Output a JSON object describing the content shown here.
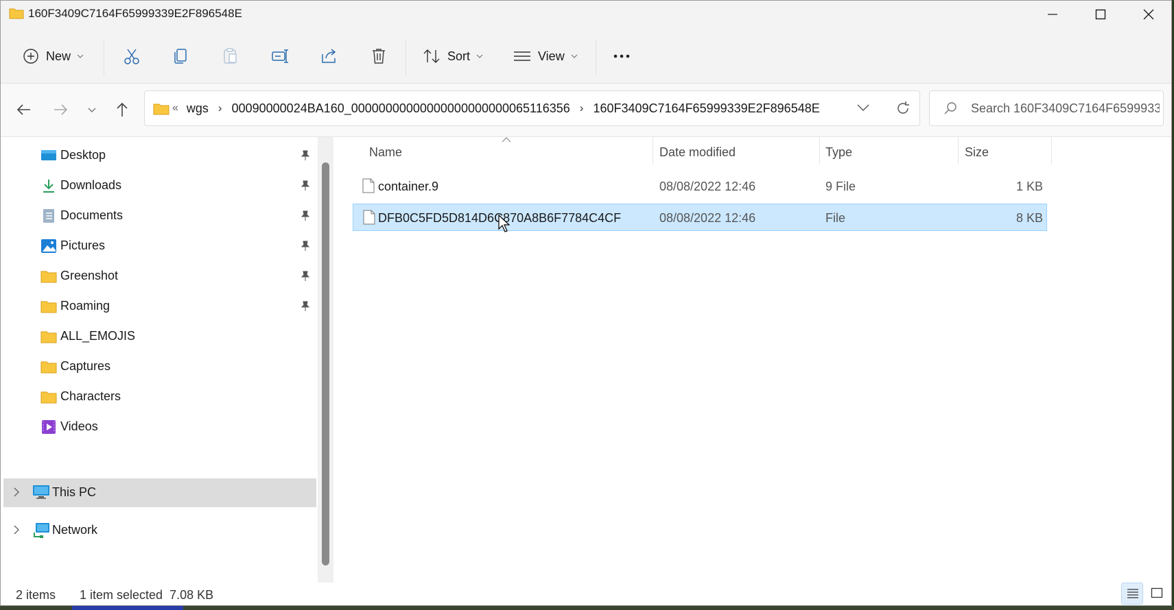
{
  "window": {
    "title": "160F3409C7164F65999339E2F896548E"
  },
  "commandbar": {
    "new_label": "New",
    "sort_label": "Sort",
    "view_label": "View"
  },
  "address": {
    "overflow": "«",
    "crumbs": [
      "wgs",
      "00090000024BA160_00000000000000000000000065116356",
      "160F3409C7164F65999339E2F896548E"
    ]
  },
  "search": {
    "placeholder": "Search 160F3409C7164F6599933..."
  },
  "sidebar": {
    "items": [
      {
        "label": "Desktop",
        "icon": "desktop-icon",
        "pinned": true
      },
      {
        "label": "Downloads",
        "icon": "downloads-icon",
        "pinned": true
      },
      {
        "label": "Documents",
        "icon": "documents-icon",
        "pinned": true
      },
      {
        "label": "Pictures",
        "icon": "pictures-icon",
        "pinned": true
      },
      {
        "label": "Greenshot",
        "icon": "folder-icon",
        "pinned": true
      },
      {
        "label": "Roaming",
        "icon": "folder-icon",
        "pinned": true
      },
      {
        "label": "ALL_EMOJIS",
        "icon": "folder-icon",
        "pinned": false
      },
      {
        "label": "Captures",
        "icon": "folder-icon",
        "pinned": false
      },
      {
        "label": "Characters",
        "icon": "folder-icon",
        "pinned": false
      },
      {
        "label": "Videos",
        "icon": "videos-icon",
        "pinned": false
      }
    ],
    "groups": [
      {
        "label": "This PC",
        "icon": "this-pc-icon",
        "selected": true
      },
      {
        "label": "Network",
        "icon": "network-icon",
        "selected": false
      }
    ]
  },
  "columns": {
    "name": "Name",
    "date": "Date modified",
    "type": "Type",
    "size": "Size"
  },
  "files": [
    {
      "name": "container.9",
      "date": "08/08/2022 12:46",
      "type": "9 File",
      "size": "1 KB",
      "selected": false
    },
    {
      "name": "DFB0C5FD5D814D6C870A8B6F7784C4CF",
      "date": "08/08/2022 12:46",
      "type": "File",
      "size": "8 KB",
      "selected": true
    }
  ],
  "status": {
    "count": "2 items",
    "selection": "1 item selected  7.08 KB"
  },
  "colors": {
    "selection_bg": "#cce8ff",
    "selection_border": "#99d1ff",
    "folder_yellow": "#f8c73f"
  }
}
